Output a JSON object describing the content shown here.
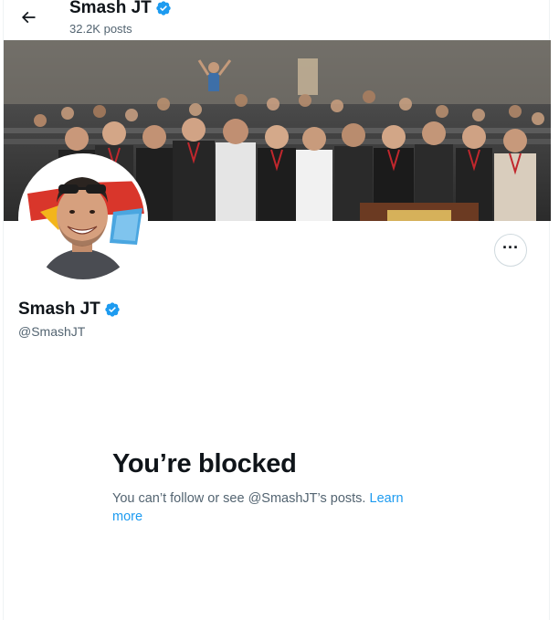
{
  "header": {
    "name": "Smash JT",
    "posts_count": "32.2K posts"
  },
  "profile": {
    "name": "Smash JT",
    "handle": "@SmashJT"
  },
  "blocked": {
    "title": "You’re blocked",
    "message": "You can’t follow or see @SmashJT’s posts.",
    "link_label": "Learn more"
  },
  "icons": {
    "back": "arrow-left-icon",
    "verified": "verified-badge-icon",
    "more": "more-options-icon"
  },
  "colors": {
    "accent": "#1d9bf0",
    "text_primary": "#0f1419",
    "text_secondary": "#536471"
  }
}
